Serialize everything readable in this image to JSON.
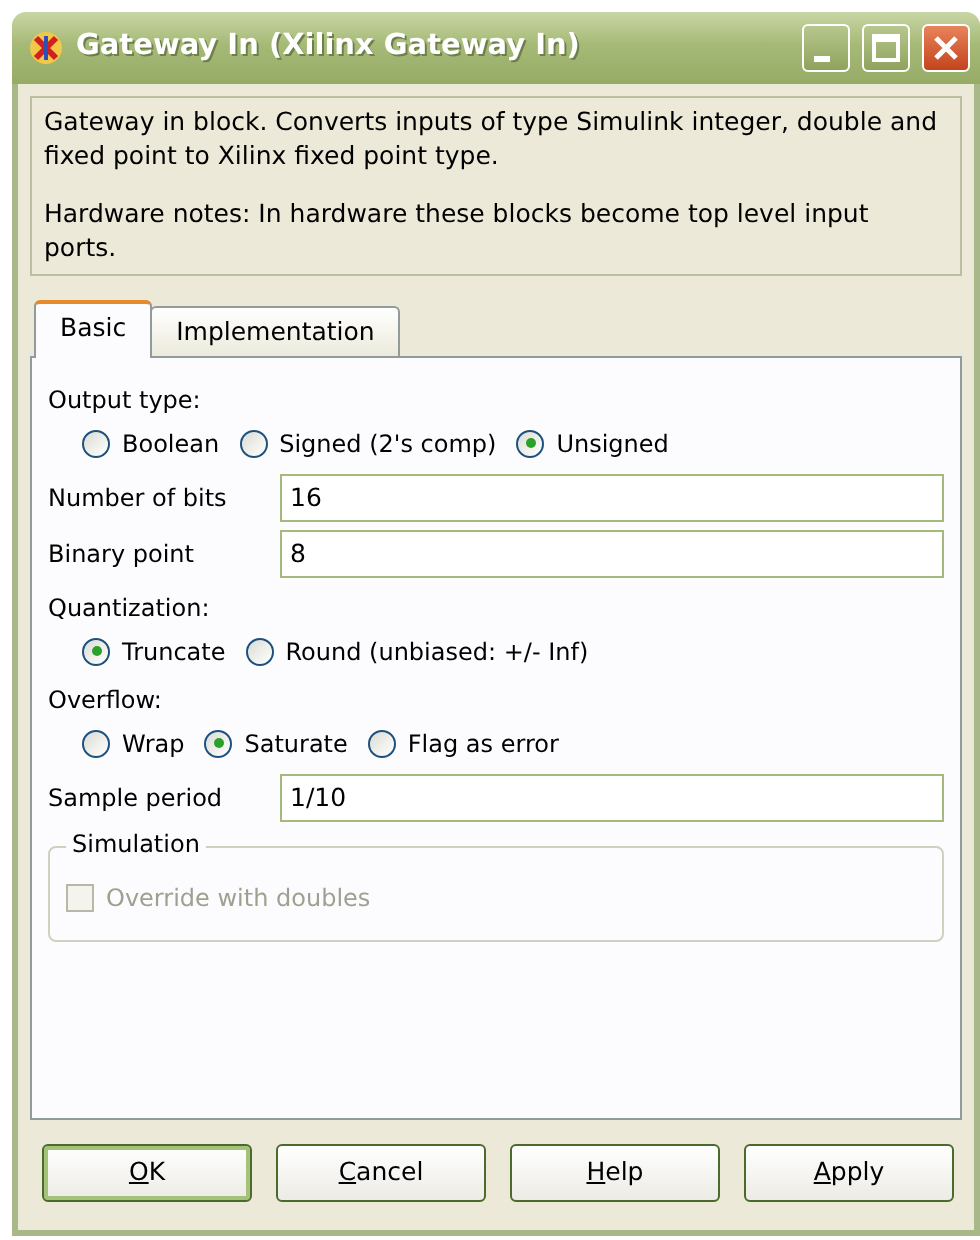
{
  "window": {
    "title": "Gateway In (Xilinx Gateway In)"
  },
  "description": [
    "Gateway in block. Converts inputs of type Simulink integer, double and fixed point to Xilinx fixed point type.",
    "Hardware notes: In hardware these blocks become top level input ports."
  ],
  "tabs": [
    {
      "label": "Basic",
      "selected": true
    },
    {
      "label": "Implementation",
      "selected": false
    }
  ],
  "fields": [
    {
      "kind": "radio_group",
      "label": "Output type:",
      "options": [
        {
          "label": "Boolean",
          "selected": false
        },
        {
          "label": "Signed (2's comp)",
          "selected": false
        },
        {
          "label": "Unsigned",
          "selected": true
        }
      ]
    },
    {
      "kind": "text",
      "label": "Number of bits",
      "value": "16"
    },
    {
      "kind": "text",
      "label": "Binary point",
      "value": "8"
    },
    {
      "kind": "radio_group",
      "label": "Quantization:",
      "options": [
        {
          "label": "Truncate",
          "selected": true
        },
        {
          "label": "Round (unbiased: +/- Inf)",
          "selected": false
        }
      ]
    },
    {
      "kind": "radio_group",
      "label": "Overflow:",
      "options": [
        {
          "label": "Wrap",
          "selected": false
        },
        {
          "label": "Saturate",
          "selected": true
        },
        {
          "label": "Flag as error",
          "selected": false
        }
      ]
    },
    {
      "kind": "text",
      "label": "Sample period",
      "value": "1/10"
    }
  ],
  "simulation": {
    "title": "Simulation",
    "checkbox": {
      "label": "Override with doubles",
      "checked": false,
      "disabled": true
    }
  },
  "buttons": [
    {
      "label": "OK",
      "default": true
    },
    {
      "label": "Cancel",
      "default": false
    },
    {
      "label": "Help",
      "default": false
    },
    {
      "label": "Apply",
      "default": false
    }
  ]
}
